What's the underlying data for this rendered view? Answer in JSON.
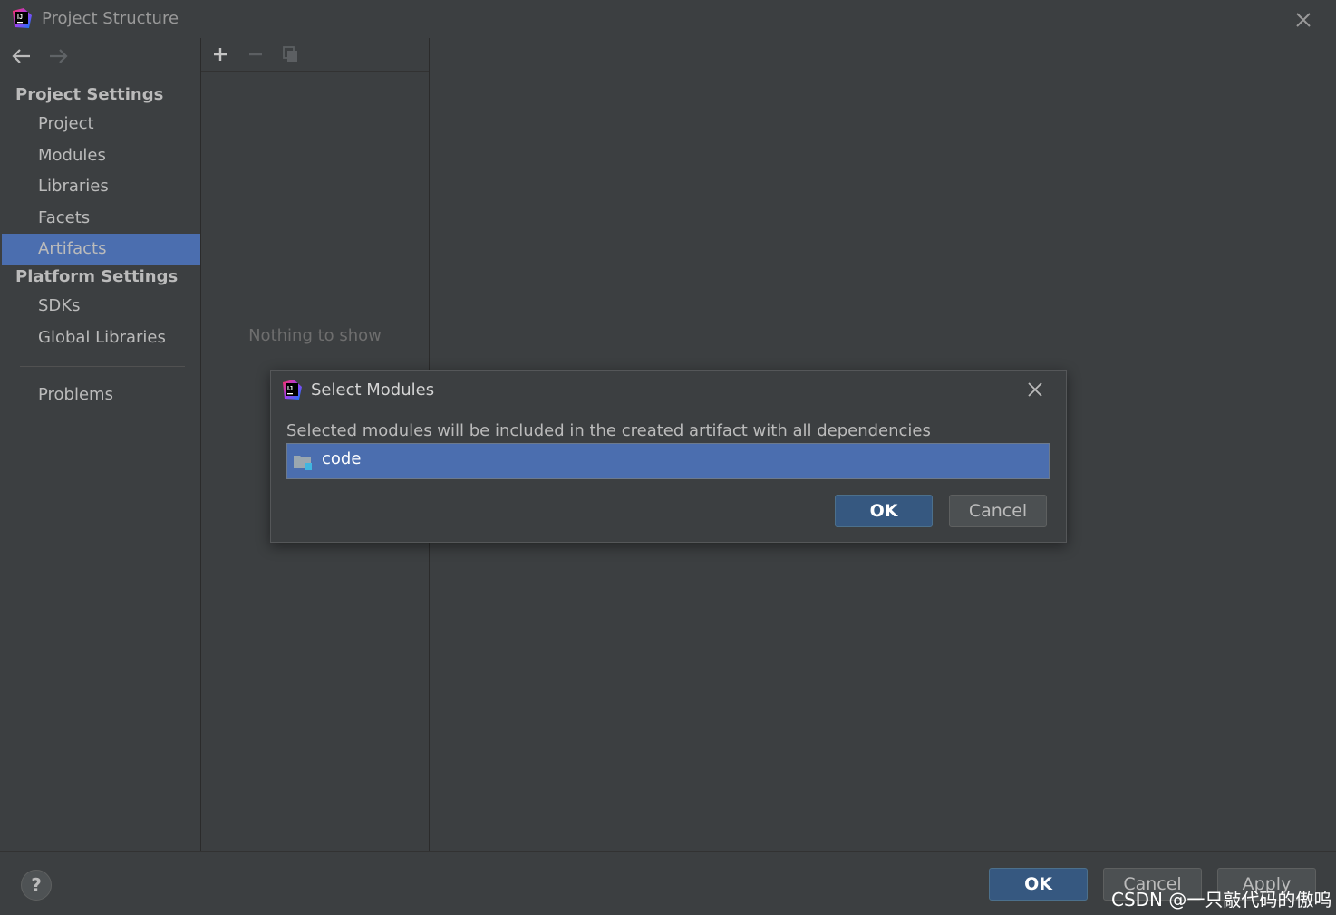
{
  "window": {
    "title": "Project Structure"
  },
  "sidebar": {
    "project_settings_heading": "Project Settings",
    "project_items": [
      {
        "label": "Project"
      },
      {
        "label": "Modules"
      },
      {
        "label": "Libraries"
      },
      {
        "label": "Facets"
      },
      {
        "label": "Artifacts",
        "selected": true
      }
    ],
    "platform_settings_heading": "Platform Settings",
    "platform_items": [
      {
        "label": "SDKs"
      },
      {
        "label": "Global Libraries"
      }
    ],
    "other_items": [
      {
        "label": "Problems"
      }
    ]
  },
  "list_pane": {
    "toolbar_icons": [
      "add-icon",
      "remove-icon",
      "copy-icon"
    ],
    "empty_text": "Nothing to show"
  },
  "footer": {
    "help_label": "?",
    "ok_label": "OK",
    "cancel_label": "Cancel",
    "apply_label": "Apply",
    "watermark": "CSDN @一只敲代码的傲呜"
  },
  "dialog": {
    "title": "Select Modules",
    "description": "Selected modules will be included in the created artifact with all dependencies",
    "modules": [
      {
        "name": "code",
        "selected": true,
        "icon": "module-folder-icon"
      }
    ],
    "ok_label": "OK",
    "cancel_label": "Cancel"
  },
  "colors": {
    "background": "#3c3f41",
    "selection": "#4b6eaf",
    "primary_button": "#365880",
    "text": "#bbbbbb"
  }
}
